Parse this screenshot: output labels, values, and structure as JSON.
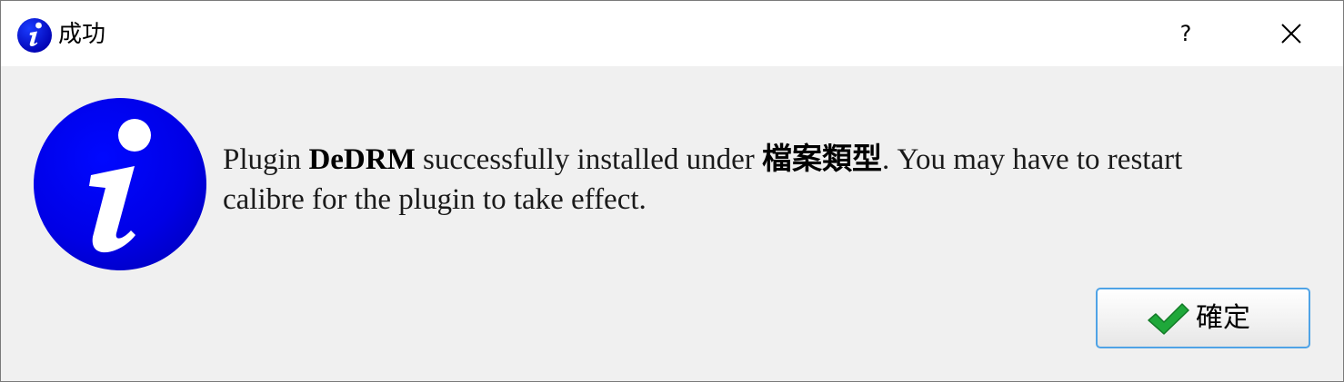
{
  "window": {
    "title": "成功",
    "help_label": "?"
  },
  "message": {
    "part1": "Plugin ",
    "plugin_name": "DeDRM",
    "part2": " successfully installed under ",
    "category": "檔案類型",
    "part3": ". You may have to restart calibre for the plugin to take effect."
  },
  "buttons": {
    "ok_label": "確定"
  },
  "colors": {
    "info_blue": "#0000e0",
    "check_green": "#1fa83a",
    "button_border": "#4fa3e6"
  },
  "icons": {
    "title": "info-icon",
    "main": "info-icon",
    "ok": "checkmark-icon",
    "close": "close-icon"
  }
}
